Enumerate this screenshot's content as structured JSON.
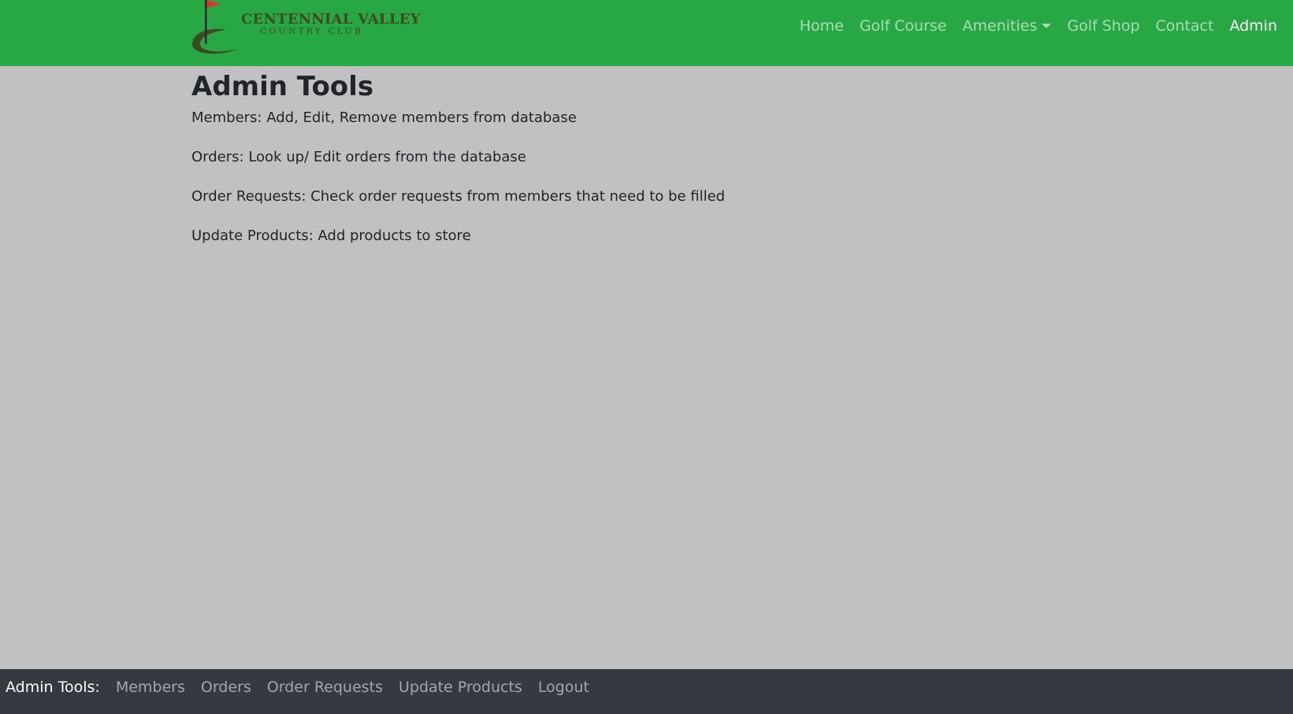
{
  "brand": {
    "line1": "CENTENNIAL VALLEY",
    "line2": "COUNTRY CLUB",
    "flag_color": "#d9342b",
    "logo_color": "#3f4a22",
    "icon": "golf-flag-logo"
  },
  "navbar": {
    "background": "#28a745",
    "items": [
      {
        "label": "Home"
      },
      {
        "label": "Golf Course"
      },
      {
        "label": "Amenities"
      },
      {
        "label": "Golf Shop"
      },
      {
        "label": "Contact"
      },
      {
        "label": "Admin"
      }
    ]
  },
  "main": {
    "title": "Admin Tools",
    "lines": [
      "Members: Add, Edit, Remove members from database",
      "Orders: Look up/ Edit orders from the database",
      "Order Requests: Check order requests from members that need to be filled",
      "Update Products: Add products to store"
    ]
  },
  "footer": {
    "background": "#343a40",
    "title": "Admin Tools:",
    "links": [
      {
        "label": "Members"
      },
      {
        "label": "Orders"
      },
      {
        "label": "Order Requests"
      },
      {
        "label": "Update Products"
      },
      {
        "label": "Logout"
      }
    ]
  }
}
